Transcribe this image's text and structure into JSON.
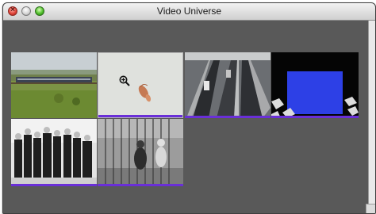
{
  "window": {
    "title": "Video Universe"
  },
  "clips": [
    {
      "name": "train-countryside"
    },
    {
      "name": "microscope-specimen"
    },
    {
      "name": "highway-traffic"
    },
    {
      "name": "blue-screen-checkerboard"
    },
    {
      "name": "crowd-portrait"
    },
    {
      "name": "zoo-cage"
    }
  ],
  "colors": {
    "selection_bar": "#6a2fd8",
    "background": "#595959"
  }
}
